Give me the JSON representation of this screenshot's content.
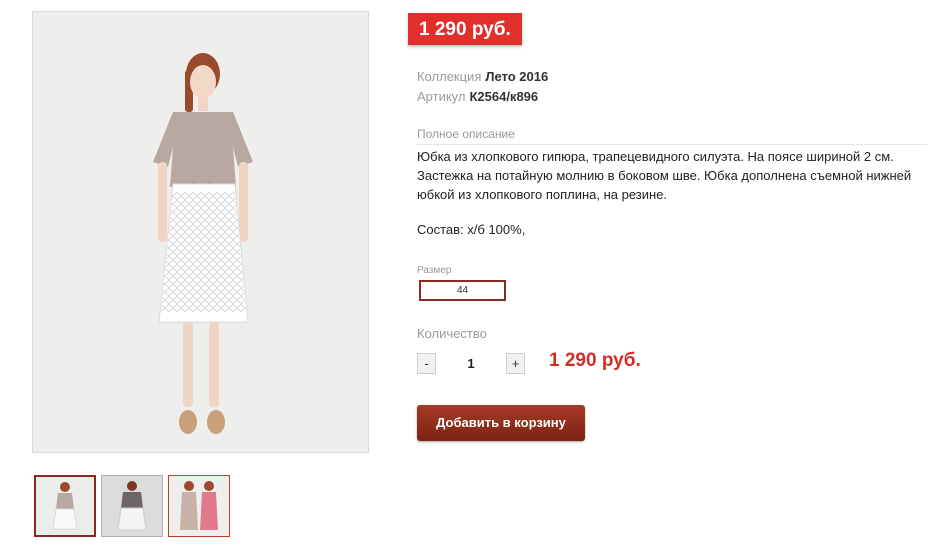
{
  "product": {
    "price": "1 290 руб.",
    "collection_label": "Коллекция",
    "collection_value": "Лето 2016",
    "article_label": "Артикул",
    "article_value": "К2564/к896",
    "description_heading": "Полное описание",
    "description_lines": [
      "Юбка из хлопкового гипюра, трапецевидного силуэта. На поясе шириной 2 см.",
      "Застежка на потайную молнию в боковом шве. Юбка дополнена съемной нижней",
      "юбкой из хлопкового поплина, на резине."
    ],
    "composition": "Состав: х/б 100%,"
  },
  "size": {
    "label": "Размер",
    "selected": "44"
  },
  "quantity": {
    "label": "Количество",
    "minus": "-",
    "value": "1",
    "plus": "+"
  },
  "total_price": "1 290 руб.",
  "add_to_cart": "Добавить в корзину",
  "gallery": {
    "thumbnails": 3,
    "active_index": 0
  },
  "colors": {
    "badge_red": "#e12f2b",
    "accent_dark_red": "#8a2a1c",
    "price_red": "#d32c24"
  }
}
